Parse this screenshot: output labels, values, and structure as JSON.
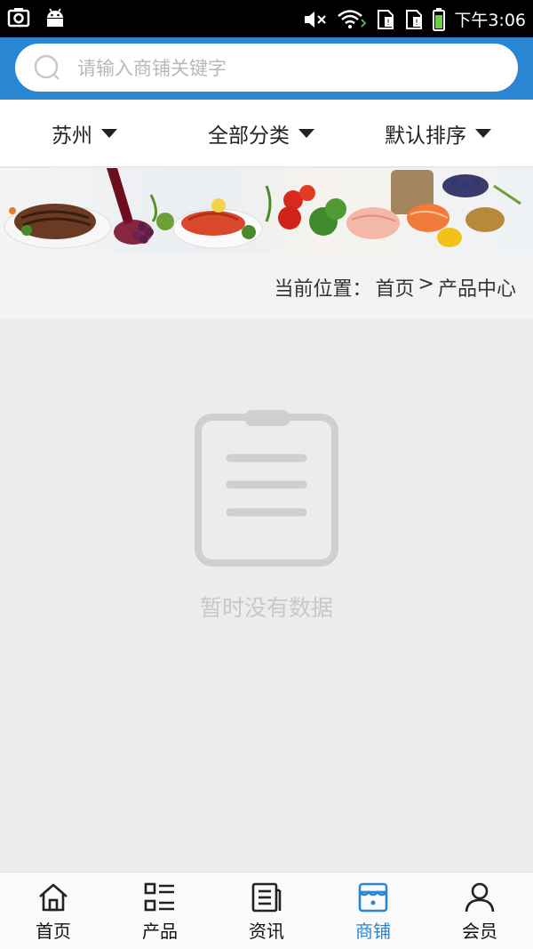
{
  "status_bar": {
    "time": "下午3:06"
  },
  "search": {
    "placeholder": "请输入商铺关键字"
  },
  "filters": [
    {
      "label": "苏州"
    },
    {
      "label": "全部分类"
    },
    {
      "label": "默认排序"
    }
  ],
  "breadcrumb": {
    "prefix": "当前位置：",
    "home": "首页",
    "separator": ">",
    "current": "产品中心"
  },
  "empty_state": {
    "message": "暂时没有数据"
  },
  "bottom_nav": {
    "items": [
      {
        "label": "首页",
        "icon": "home-icon"
      },
      {
        "label": "产品",
        "icon": "product-list-icon"
      },
      {
        "label": "资讯",
        "icon": "news-icon"
      },
      {
        "label": "商铺",
        "icon": "shop-icon",
        "active": true
      },
      {
        "label": "会员",
        "icon": "user-icon"
      }
    ]
  },
  "colors": {
    "accent": "#2a86d1",
    "background": "#ececec"
  }
}
